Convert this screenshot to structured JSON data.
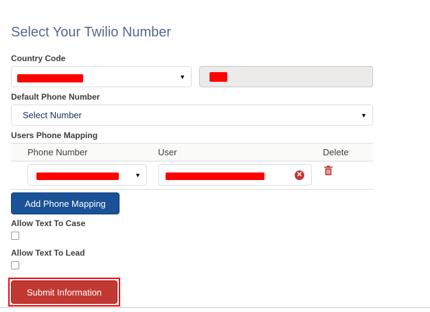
{
  "page": {
    "title": "Select Your Twilio Number"
  },
  "country_code": {
    "label": "Country Code"
  },
  "default_phone": {
    "label": "Default Phone Number",
    "selected": "Select Number"
  },
  "mapping": {
    "label": "Users Phone Mapping",
    "columns": [
      "Phone Number",
      "User",
      "Delete"
    ]
  },
  "buttons": {
    "add_mapping": "Add Phone Mapping",
    "submit": "Submit Information"
  },
  "options": {
    "allow_text_to_case": "Allow Text To Case",
    "allow_text_to_lead": "Allow Text To Lead"
  },
  "icons": {
    "caret": "chevron-down-icon",
    "clear": "close-icon",
    "delete": "trash-icon"
  },
  "colors": {
    "brand": "#1b5297",
    "destructive": "#c23934",
    "redaction": "#ff0000"
  }
}
